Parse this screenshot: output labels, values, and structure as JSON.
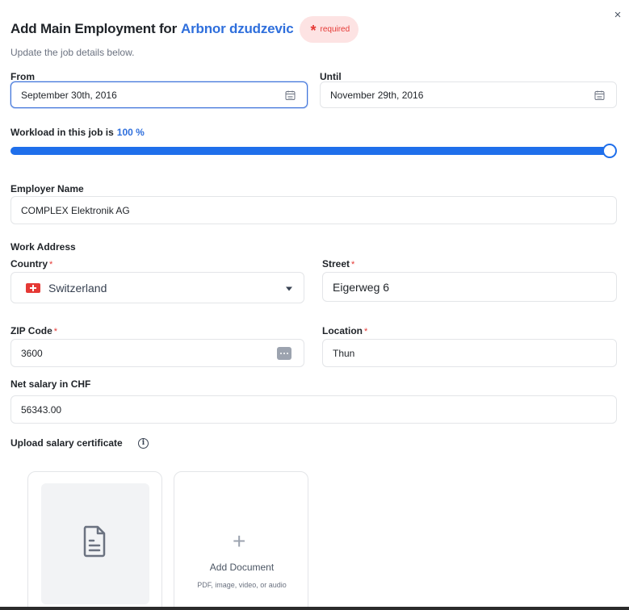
{
  "dialog": {
    "title": "Add Main Employment for",
    "person_name": "Arbnor dzudzevic",
    "required_badge": "required",
    "subtitle": "Update the job details below.",
    "close_glyph": "×"
  },
  "dates": {
    "from_label": "From",
    "from_value": "September 30th, 2016",
    "until_label": "Until",
    "until_value": "November 29th, 2016"
  },
  "workload": {
    "label": "Workload in this job is",
    "value_text": "100 %",
    "percent": 100
  },
  "employer": {
    "label": "Employer Name",
    "value": "COMPLEX Elektronik AG"
  },
  "address": {
    "section_label": "Work Address",
    "country_label": "Country",
    "country_value": "Switzerland",
    "street_label": "Street",
    "street_value": "Eigerweg 6",
    "zip_label": "ZIP Code",
    "zip_value": "3600",
    "location_label": "Location",
    "location_value": "Thun",
    "required_mark": "*"
  },
  "salary": {
    "label": "Net salary in CHF",
    "value": "56343.00"
  },
  "upload": {
    "label": "Upload salary certificate",
    "info_glyph": "i",
    "add_plus": "+",
    "add_title": "Add Document",
    "add_subtitle": "PDF, image, video, or audio"
  },
  "icons": {
    "close": "close-icon",
    "calendar": "calendar-icon",
    "info": "info-icon",
    "document": "document-icon",
    "plus": "plus-icon",
    "dropdown": "chevron-down-icon",
    "flag": "switzerland-flag-icon",
    "autofill": "more-dots-icon"
  },
  "colors": {
    "accent": "#1f6feb",
    "link": "#2f6fdc",
    "required": "#e53935",
    "required_bg": "#fde3e3"
  }
}
